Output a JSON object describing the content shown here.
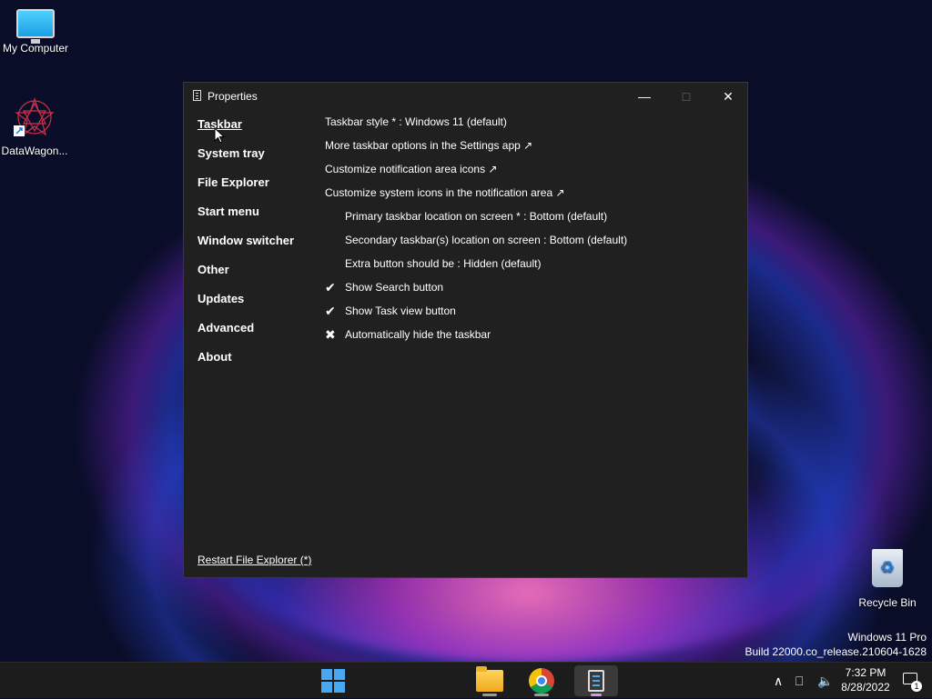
{
  "desktop": {
    "icons": [
      {
        "label": "My Computer"
      },
      {
        "label": "DataWagon..."
      },
      {
        "label": "Recycle Bin"
      }
    ],
    "watermark": {
      "line1": "Windows 11 Pro",
      "line2": "Build 22000.co_release.210604-1628"
    }
  },
  "window": {
    "title": "Properties",
    "controls": {
      "minimize": "—",
      "maximize": "□",
      "close": "✕"
    },
    "nav": {
      "items": [
        {
          "label": "Taskbar",
          "active": true
        },
        {
          "label": "System tray"
        },
        {
          "label": "File Explorer"
        },
        {
          "label": "Start menu"
        },
        {
          "label": "Window switcher"
        },
        {
          "label": "Other"
        },
        {
          "label": "Updates"
        },
        {
          "label": "Advanced"
        },
        {
          "label": "About"
        }
      ]
    },
    "settings": {
      "taskbar_style": "Taskbar style * : Windows 11 (default)",
      "more_options": "More taskbar options in the Settings app ↗",
      "notif_icons": "Customize notification area icons ↗",
      "system_icons": "Customize system icons in the notification area ↗",
      "primary_location": "Primary taskbar location on screen * : Bottom (default)",
      "secondary_location": "Secondary taskbar(s) location on screen : Bottom (default)",
      "extra_button": "Extra button should be : Hidden (default)",
      "show_search": {
        "label": "Show Search button",
        "mark": "✔"
      },
      "show_taskview": {
        "label": "Show Task view button",
        "mark": "✔"
      },
      "auto_hide": {
        "label": "Automatically hide the taskbar",
        "mark": "✖"
      }
    },
    "footer_link": "Restart File Explorer (*)"
  },
  "taskbar": {
    "apps": [
      "start-icon",
      "file-explorer-icon",
      "chrome-icon",
      "properties-app-icon"
    ],
    "tray": {
      "chevron": "∧",
      "network": "⎕",
      "volume": "🔈"
    },
    "clock": {
      "time": "7:32 PM",
      "date": "8/28/2022"
    },
    "notification_count": "1"
  }
}
